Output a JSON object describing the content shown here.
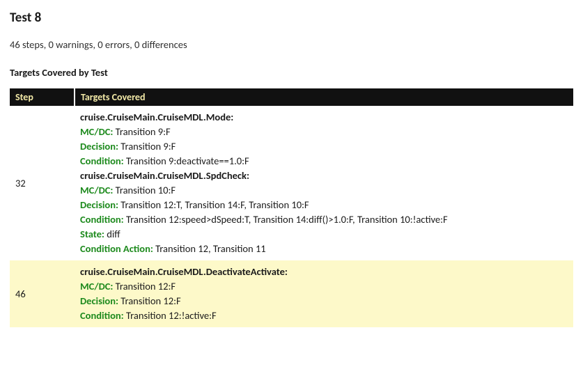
{
  "title": "Test 8",
  "summary": "46 steps, 0 warnings, 0 errors, 0 differences",
  "section_title": "Targets Covered by Test",
  "headers": {
    "step": "Step",
    "targets": "Targets Covered"
  },
  "rows": [
    {
      "step": "32",
      "groups": [
        {
          "object": "cruise.CruiseMain.CruiseMDL.Mode:",
          "metrics": [
            {
              "label": "MC/DC:",
              "value": " Transition 9:F"
            },
            {
              "label": "Decision:",
              "value": " Transition 9:F"
            },
            {
              "label": "Condition:",
              "value": " Transition 9:deactivate==1.0:F"
            }
          ]
        },
        {
          "object": "cruise.CruiseMain.CruiseMDL.SpdCheck:",
          "metrics": [
            {
              "label": "MC/DC:",
              "value": " Transition 10:F"
            },
            {
              "label": "Decision:",
              "value": " Transition 12:T, Transition 14:F, Transition 10:F"
            },
            {
              "label": "Condition:",
              "value": " Transition 12:speed>dSpeed:T, Transition 14:diff()>1.0:F, Transition 10:!active:F"
            },
            {
              "label": "State:",
              "value": " diff"
            },
            {
              "label": "Condition Action:",
              "value": " Transition 12, Transition 11"
            }
          ]
        }
      ]
    },
    {
      "step": "46",
      "groups": [
        {
          "object": "cruise.CruiseMain.CruiseMDL.DeactivateActivate:",
          "metrics": [
            {
              "label": "MC/DC:",
              "value": " Transition 12:F"
            },
            {
              "label": "Decision:",
              "value": " Transition 12:F"
            },
            {
              "label": "Condition:",
              "value": " Transition 12:!active:F"
            }
          ]
        }
      ]
    }
  ]
}
